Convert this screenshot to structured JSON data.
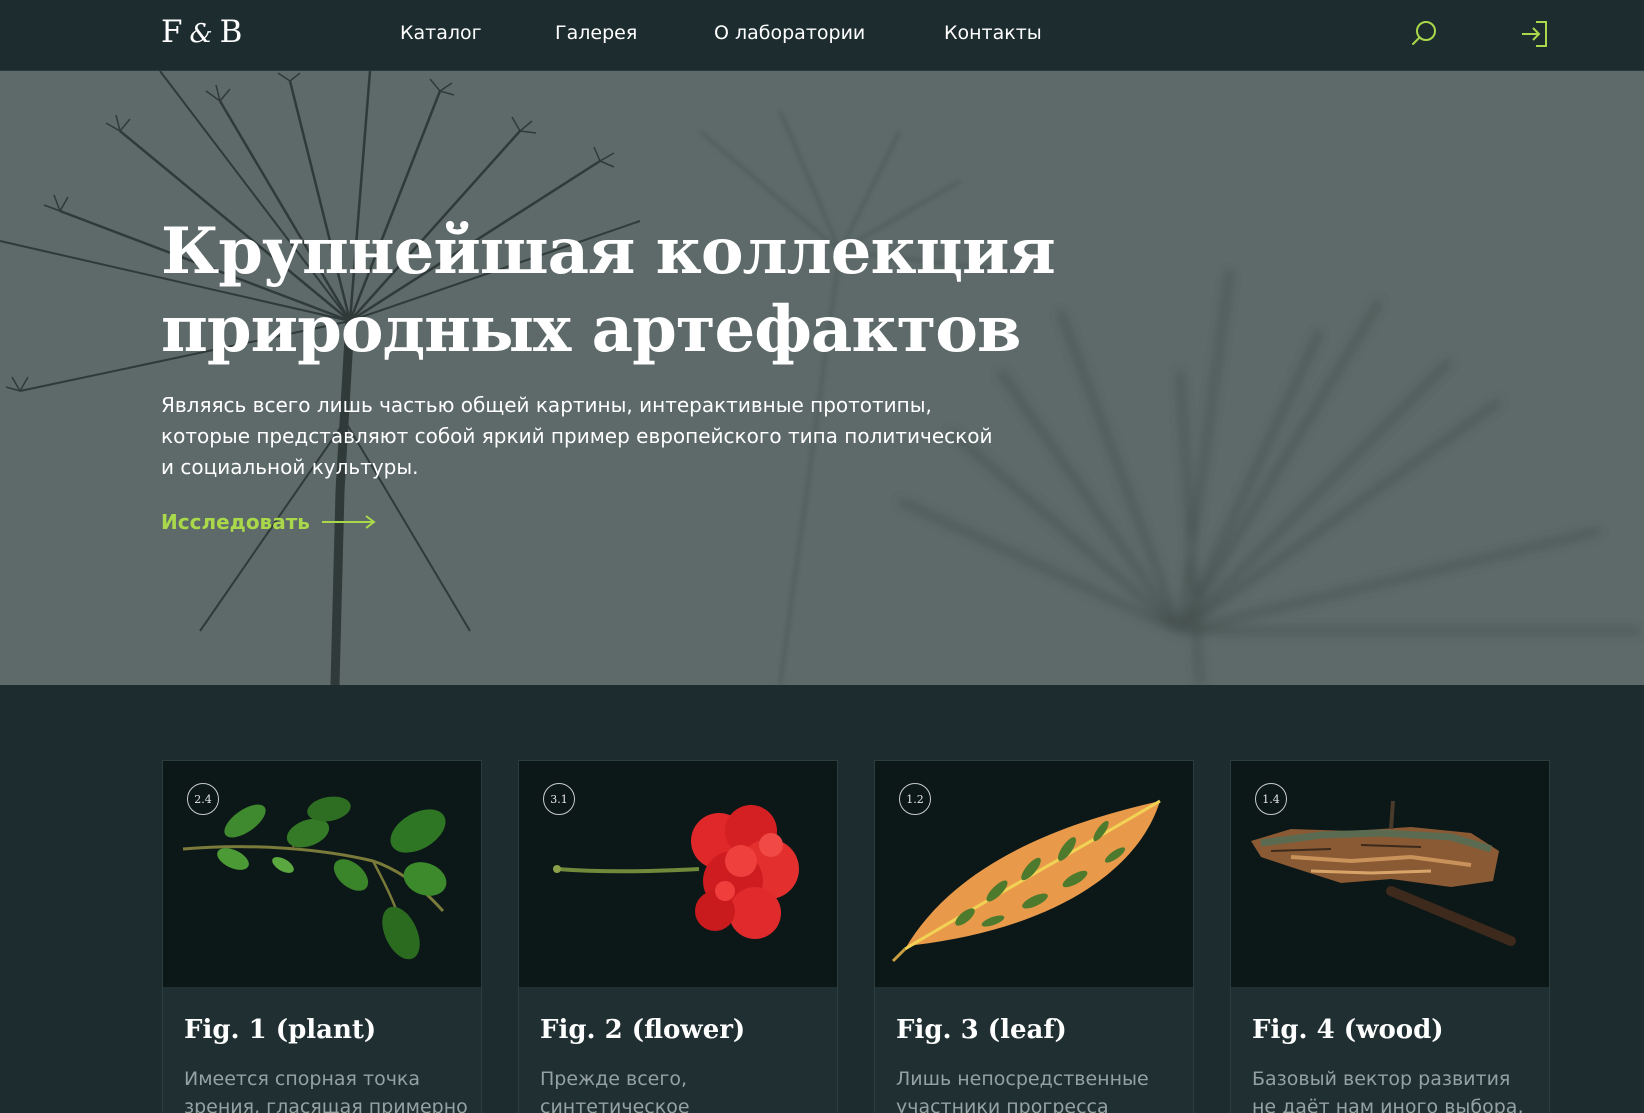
{
  "header": {
    "logo": {
      "left": "F",
      "amp": "&",
      "right": "B"
    },
    "nav": [
      {
        "label": "Каталог"
      },
      {
        "label": "Галерея"
      },
      {
        "label": "О лаборатории"
      },
      {
        "label": "Контакты"
      }
    ],
    "icons": {
      "search": "search-icon",
      "login": "login-icon"
    }
  },
  "hero": {
    "title_line1": "Крупнейшая коллекция",
    "title_line2": "природных артефактов",
    "text": "Являясь всего лишь частью общей картины, интерактивные прототипы, которые представляют собой яркий пример европейского типа политической и социальной культуры.",
    "cta_label": "Исследовать"
  },
  "cards": [
    {
      "badge": "2.4",
      "title": "Fig. 1 (plant)",
      "desc": "Имеется спорная точка зрения, гласящая примерно"
    },
    {
      "badge": "3.1",
      "title": "Fig. 2 (flower)",
      "desc": "Прежде всего, синтетическое"
    },
    {
      "badge": "1.2",
      "title": "Fig. 3 (leaf)",
      "desc": "Лишь непосредственные участники прогресса"
    },
    {
      "badge": "1.4",
      "title": "Fig. 4 (wood)",
      "desc": "Базовый вектор развития не даёт нам иного выбора,"
    }
  ],
  "colors": {
    "background": "#1d2c2f",
    "accent": "#a9d94a",
    "hero": "#5d6a69",
    "card_image_bg": "#0c1718",
    "muted_text": "#95a1a2"
  }
}
